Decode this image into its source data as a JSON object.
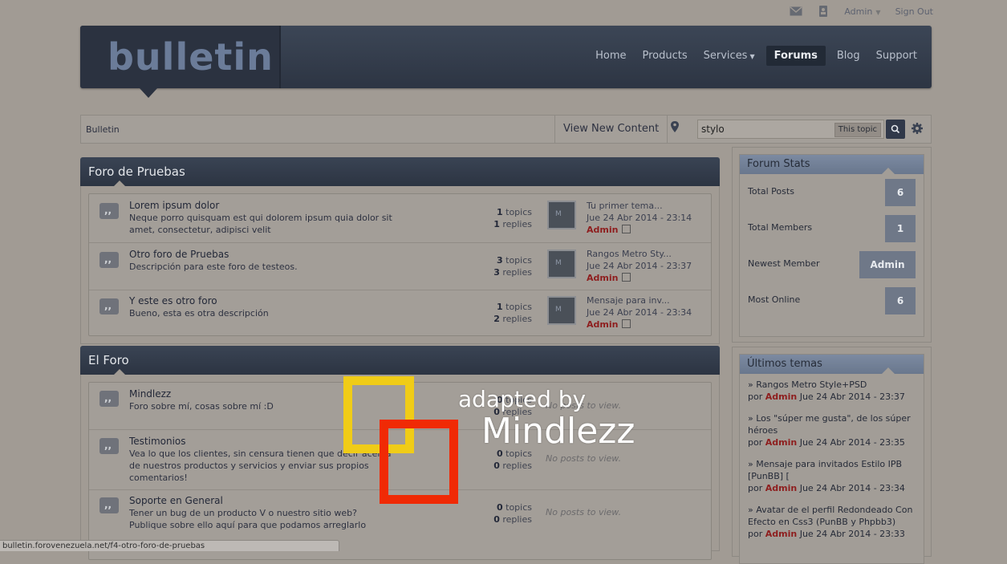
{
  "topbar": {
    "user": "Admin",
    "signout": "Sign Out"
  },
  "header": {
    "logo": "bulletin",
    "nav": [
      {
        "label": "Home"
      },
      {
        "label": "Products"
      },
      {
        "label": "Services"
      },
      {
        "label": "Forums"
      },
      {
        "label": "Blog"
      },
      {
        "label": "Support"
      }
    ]
  },
  "toolbar": {
    "breadcrumb": "Bulletin",
    "view_new": "View New Content",
    "search_value": "stylo",
    "search_scope": "This topic"
  },
  "categories": [
    {
      "title": "Foro de Pruebas",
      "forums": [
        {
          "title": "Lorem ipsum dolor",
          "desc": "Neque porro quisquam est qui dolorem ipsum quia dolor sit amet, consectetur, adipisci velit",
          "topics": "1",
          "replies": "1",
          "topics_label": "topics",
          "replies_label": "replies",
          "last_title": "Tu primer tema...",
          "last_date": "Jue 24 Abr 2014 - 23:14",
          "last_user": "Admin"
        },
        {
          "title": "Otro foro de Pruebas",
          "desc": "Descripción para este foro de testeos.",
          "topics": "3",
          "replies": "3",
          "topics_label": "topics",
          "replies_label": "replies",
          "last_title": "Rangos Metro Sty...",
          "last_date": "Jue 24 Abr 2014 - 23:37",
          "last_user": "Admin"
        },
        {
          "title": "Y este es otro foro",
          "desc": "Bueno, esta es otra descripción",
          "topics": "1",
          "replies": "2",
          "topics_label": "topics",
          "replies_label": "replies",
          "last_title": "Mensaje para inv...",
          "last_date": "Jue 24 Abr 2014 - 23:34",
          "last_user": "Admin"
        }
      ]
    },
    {
      "title": "El Foro",
      "forums": [
        {
          "title": "Mindlezz",
          "desc": "Foro sobre mí, cosas sobre mí :D",
          "topics": "0",
          "replies": "0",
          "topics_label": "topics",
          "replies_label": "replies",
          "no_posts": "No posts to view."
        },
        {
          "title": "Testimonios",
          "desc": "Vea lo que los clientes, sin censura tienen que decir acerca de nuestros productos y servicios y enviar sus propios comentarios!",
          "topics": "0",
          "replies": "0",
          "topics_label": "topics",
          "replies_label": "replies",
          "no_posts": "No posts to view."
        },
        {
          "title": "Soporte en General",
          "desc": "Tener un bug de un producto V o nuestro sitio web? Publique sobre ello aquí para que podamos arreglarlo",
          "topics": "0",
          "replies": "0",
          "topics_label": "topics",
          "replies_label": "replies",
          "no_posts": "No posts to view."
        }
      ]
    }
  ],
  "stats": {
    "title": "Forum Stats",
    "rows": [
      {
        "label": "Total Posts",
        "value": "6"
      },
      {
        "label": "Total Members",
        "value": "1"
      },
      {
        "label": "Newest Member",
        "value": "Admin"
      },
      {
        "label": "Most Online",
        "value": "6"
      }
    ]
  },
  "latest": {
    "title": "Últimos temas",
    "items": [
      {
        "title": "» Rangos Metro Style+PSD",
        "por": "por",
        "user": "Admin",
        "date": "Jue 24 Abr 2014 - 23:37"
      },
      {
        "title": "» Los \"súper me gusta\", de los súper héroes",
        "por": "por",
        "user": "Admin",
        "date": "Jue 24 Abr 2014 - 23:35"
      },
      {
        "title": "» Mensaje para invitados Estilo IPB [PunBB] [",
        "por": "por",
        "user": "Admin",
        "date": "Jue 24 Abr 2014 - 23:34"
      },
      {
        "title": "» Avatar de el perfil Redondeado Con Efecto en Css3 (PunBB y Phpbb3)",
        "por": "por",
        "user": "Admin",
        "date": "Jue 24 Abr 2014 - 23:33"
      }
    ]
  },
  "watermark": {
    "line1": "adapted by",
    "line2": "Mindlezz"
  },
  "statusbar": {
    "url": "bulletin.forovenezuela.net/f4-otro-foro-de-pruebas"
  },
  "colors": {
    "header": "#2d3543",
    "accent": "#6f7888",
    "username": "#8e1e1e",
    "watermark_yellow": "#f0cc17",
    "watermark_red": "#f02a05"
  }
}
